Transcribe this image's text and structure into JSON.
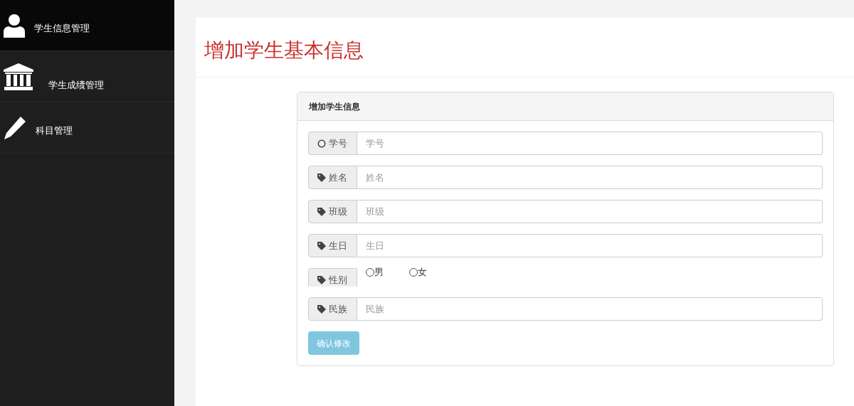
{
  "sidebar": {
    "items": [
      {
        "label": "学生信息管理",
        "selected": true
      },
      {
        "label": "学生成绩管理",
        "selected": false
      },
      {
        "label": "科目管理",
        "selected": false
      }
    ]
  },
  "page_title": "增加学生基本信息",
  "form": {
    "title": "增加学生信息",
    "fields": [
      {
        "kind": "text",
        "label": "学号",
        "placeholder": "学号"
      },
      {
        "kind": "text",
        "label": "姓名",
        "placeholder": "姓名"
      },
      {
        "kind": "text",
        "label": "班级",
        "placeholder": "班级"
      },
      {
        "kind": "text",
        "label": "生日",
        "placeholder": "生日"
      },
      {
        "kind": "radio",
        "label": "性别",
        "options": [
          {
            "label": "男",
            "selected": false
          },
          {
            "label": "女",
            "selected": false
          }
        ]
      },
      {
        "kind": "text",
        "label": "民族",
        "placeholder": "民族"
      }
    ],
    "submit": {
      "label": "确认修改",
      "disabled": true
    }
  }
}
